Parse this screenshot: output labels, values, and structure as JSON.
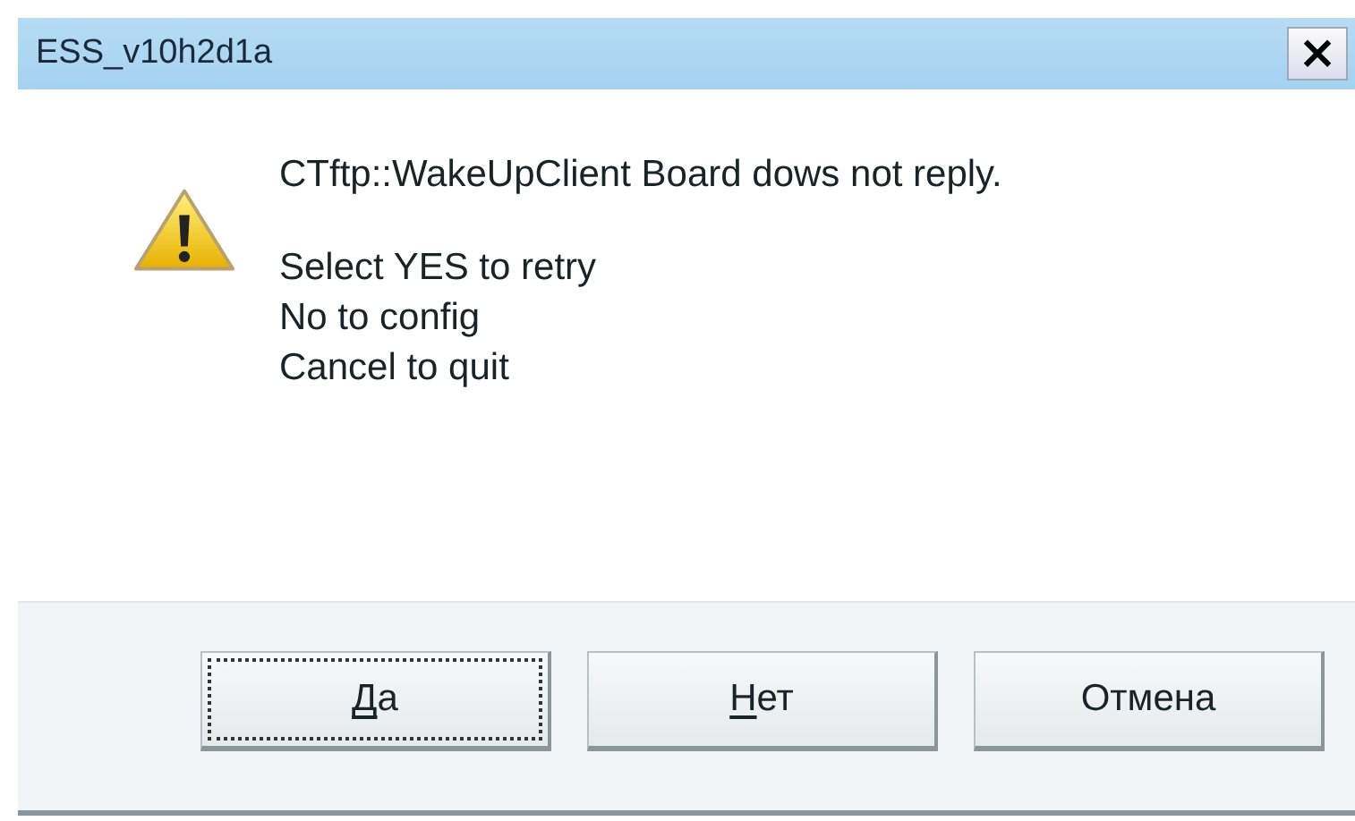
{
  "window": {
    "title": "ESS_v10h2d1a",
    "close": "×"
  },
  "message": {
    "headline": "CTftp::WakeUpClient Board dows not reply.",
    "lines": [
      "Select YES to retry",
      "No to config",
      "Cancel to quit"
    ]
  },
  "buttons": [
    {
      "kind": "mnemonic",
      "mnemonic": "Д",
      "rest": "а",
      "focused": true
    },
    {
      "kind": "mnemonic",
      "mnemonic": "Н",
      "rest": "ет",
      "focused": false
    },
    {
      "kind": "plain",
      "label": "Отмена",
      "focused": false
    }
  ]
}
